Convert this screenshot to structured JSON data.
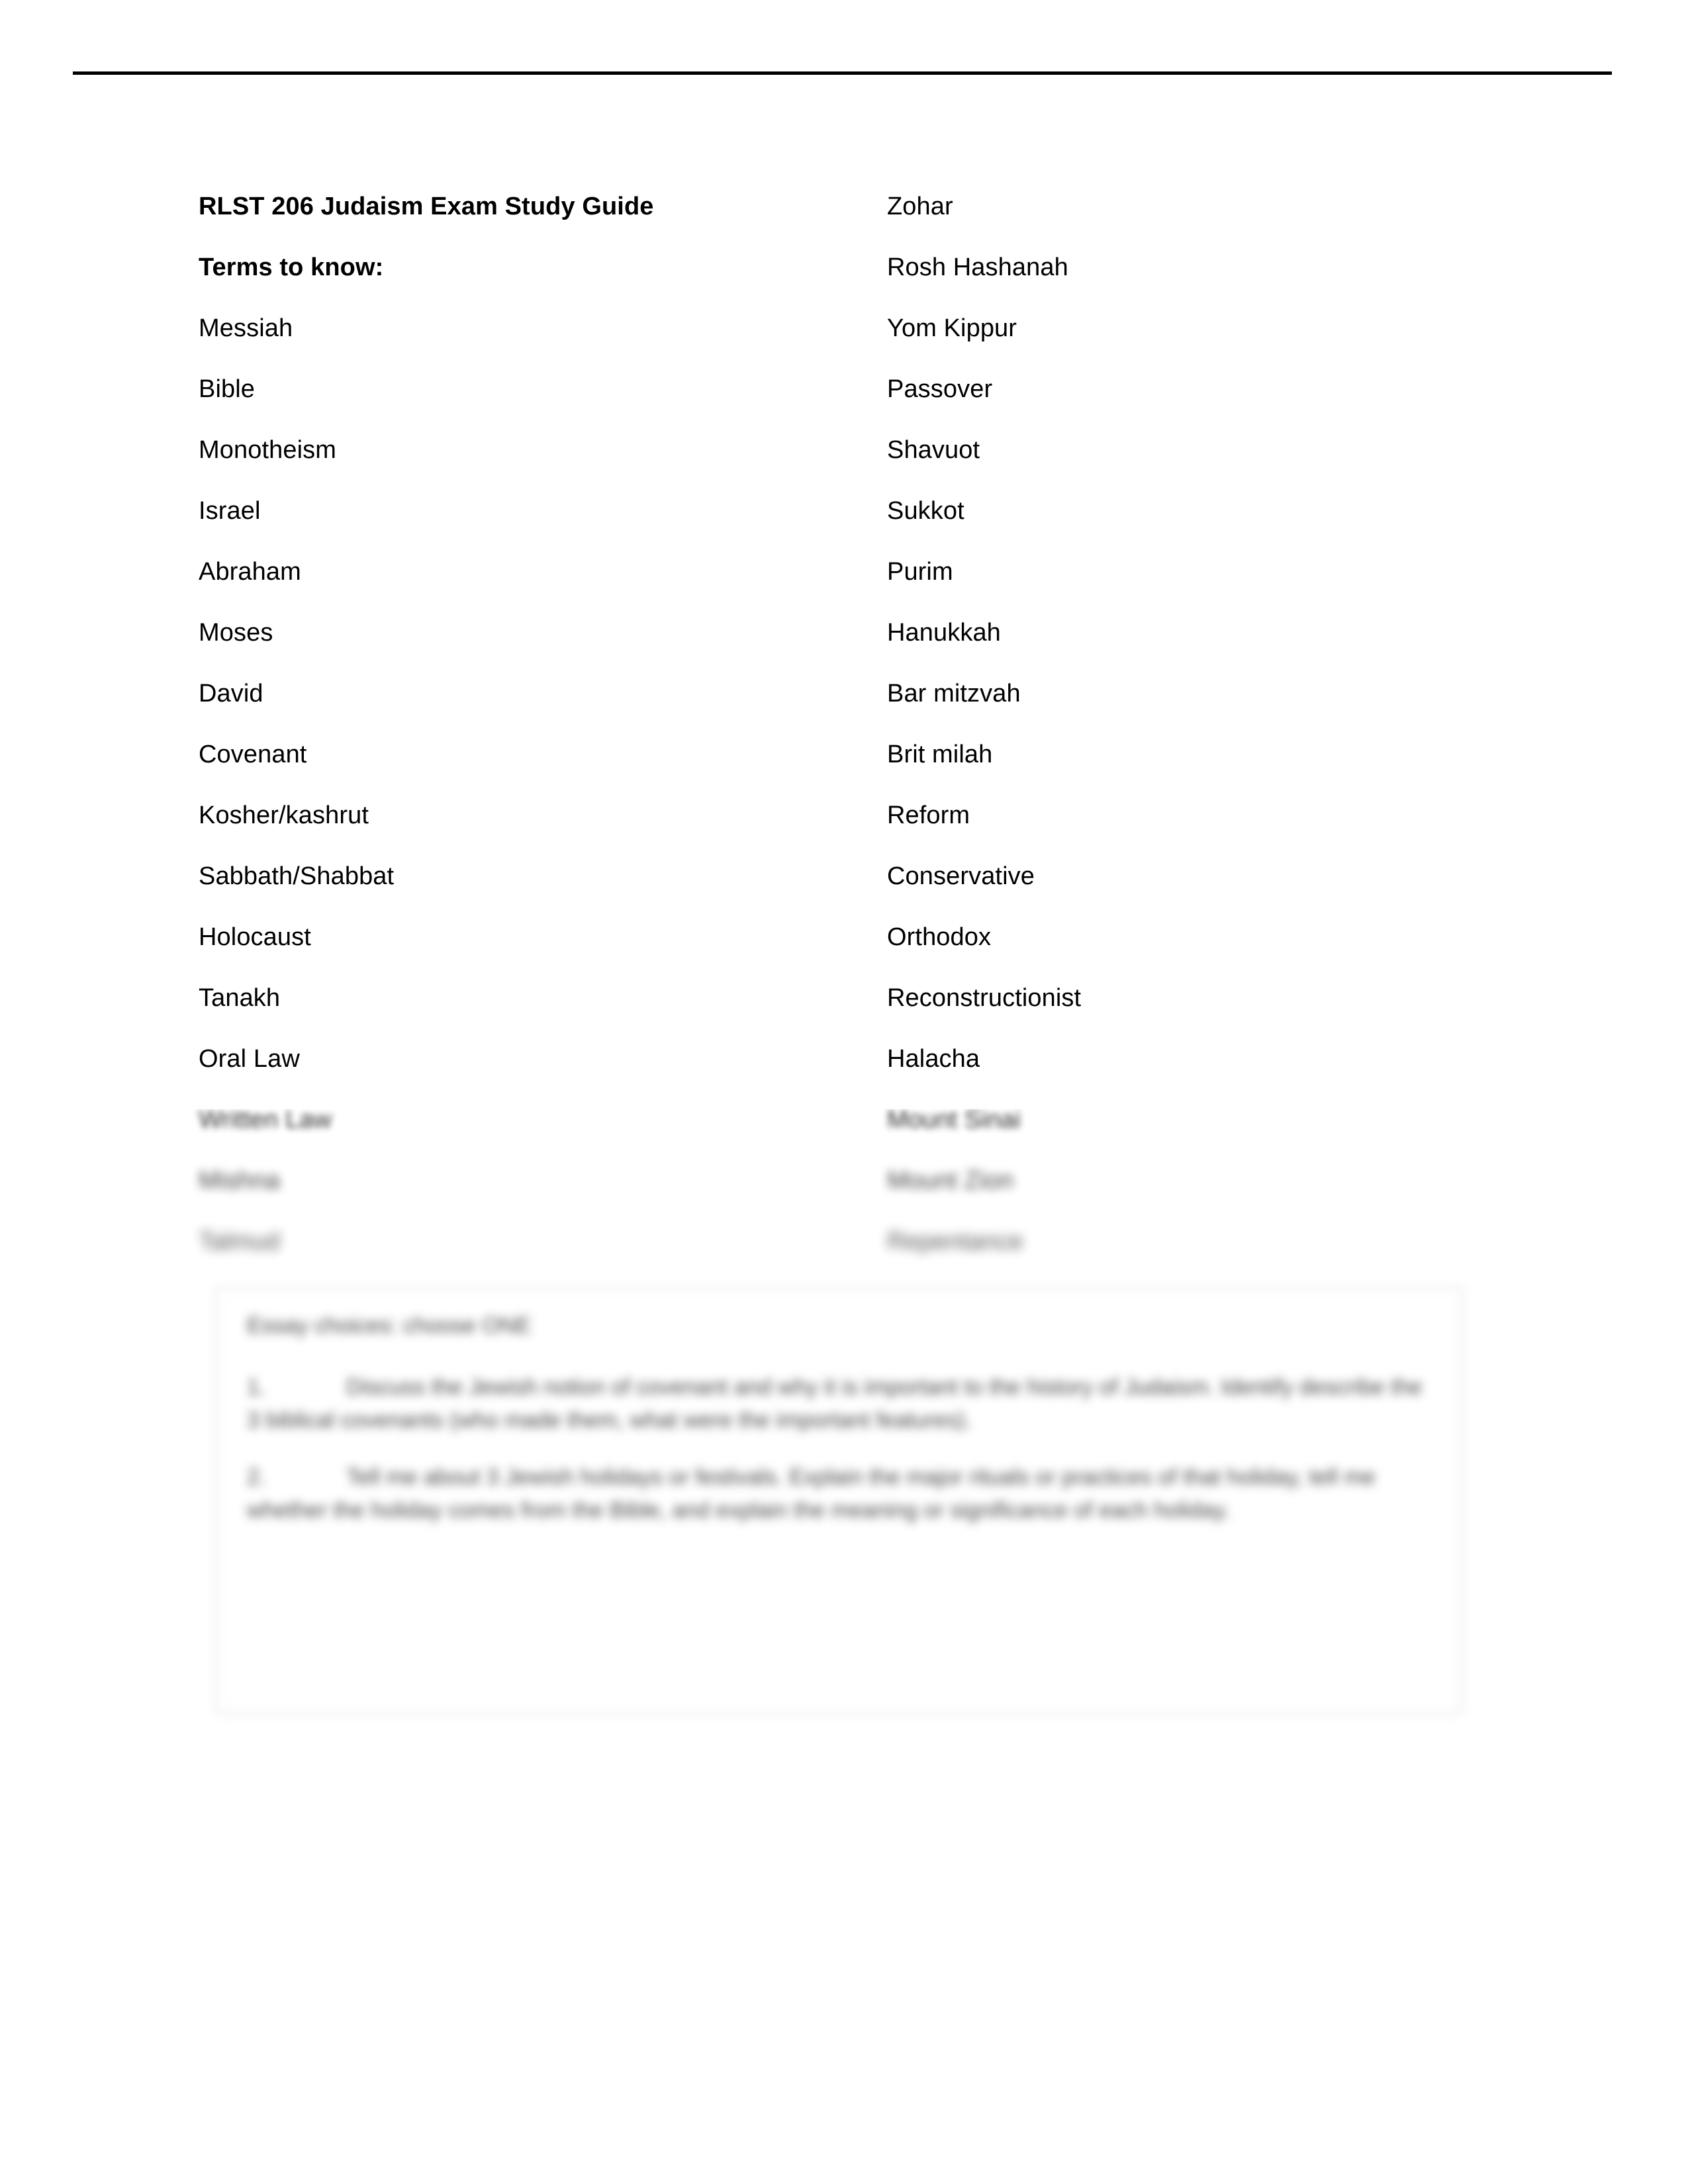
{
  "document": {
    "title": "RLST 206 Judaism Exam Study Guide",
    "section_heading": "Terms to know:",
    "left_column": [
      "Messiah",
      "Bible",
      "Monotheism",
      "Israel",
      "Abraham",
      "Moses",
      "David",
      "Covenant",
      "Kosher/kashrut",
      "Sabbath/Shabbat",
      "Holocaust",
      "Tanakh",
      "Oral Law",
      "Written Law",
      "Mishna",
      "Talmud"
    ],
    "right_column": [
      "Zohar",
      "Rosh Hashanah",
      "Yom Kippur",
      "Passover",
      "Shavuot",
      "Sukkot",
      "Purim",
      "Hanukkah",
      "Bar mitzvah",
      "Brit milah",
      "Reform",
      "Conservative",
      "Orthodox",
      "Reconstructionist",
      "Halacha",
      "Mount Sinai",
      "Mount Zion",
      "Repentance"
    ],
    "essay_box": {
      "heading": "Essay choices: choose ONE",
      "items": [
        {
          "number": "1.",
          "text": "Discuss the Jewish notion of covenant and why it is important to the history of Judaism. Identify describe the 3 biblical covenants (who made them, what were the important features)."
        },
        {
          "number": "2.",
          "text": "Tell me about 3 Jewish holidays or festivals. Explain the major rituals or practices of that holiday, tell me whether the holiday comes from the Bible, and explain the meaning or significance of each holiday."
        }
      ]
    }
  }
}
